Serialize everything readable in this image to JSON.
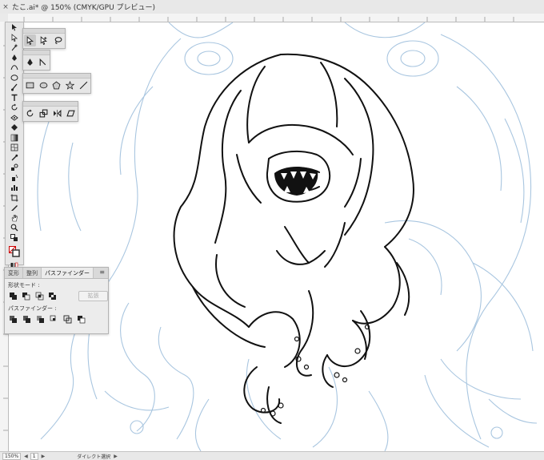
{
  "window": {
    "close_glyph": "×",
    "doc_tab": "たこ.ai* @ 150% (CMYK/GPU プレビュー)"
  },
  "toolbar": {
    "tools": [
      "selection-tool-icon",
      "direct-selection-tool-icon",
      "magic-wand-icon",
      "pen-tool-icon",
      "curvature-tool-icon",
      "ellipse-tool-icon",
      "paintbrush-tool-icon",
      "type-tool-icon",
      "rotate-tool-icon",
      "width-tool-icon",
      "shape-builder-icon",
      "gradient-tool-icon",
      "mesh-tool-icon",
      "eyedropper-tool-icon",
      "blend-tool-icon",
      "symbol-sprayer-icon",
      "graph-tool-icon",
      "artboard-tool-icon",
      "slice-tool-icon",
      "hand-tool-icon",
      "zoom-tool-icon"
    ],
    "more_glyph": "•••"
  },
  "pathfinder_panel": {
    "tabs": [
      "変形",
      "整列",
      "パスファインダー"
    ],
    "menu_glyph": "≡",
    "shape_modes_label": "形状モード :",
    "expand_button": "拡張",
    "pathfinders_label": "パスファインダー :"
  },
  "statusbar": {
    "zoom": "150%",
    "page": "1",
    "tool_name": "ダイレクト選択"
  },
  "colors": {
    "sketch_line": "#a9c6e0",
    "ink_line": "#111111",
    "panel_bg": "#e6e6e6"
  }
}
